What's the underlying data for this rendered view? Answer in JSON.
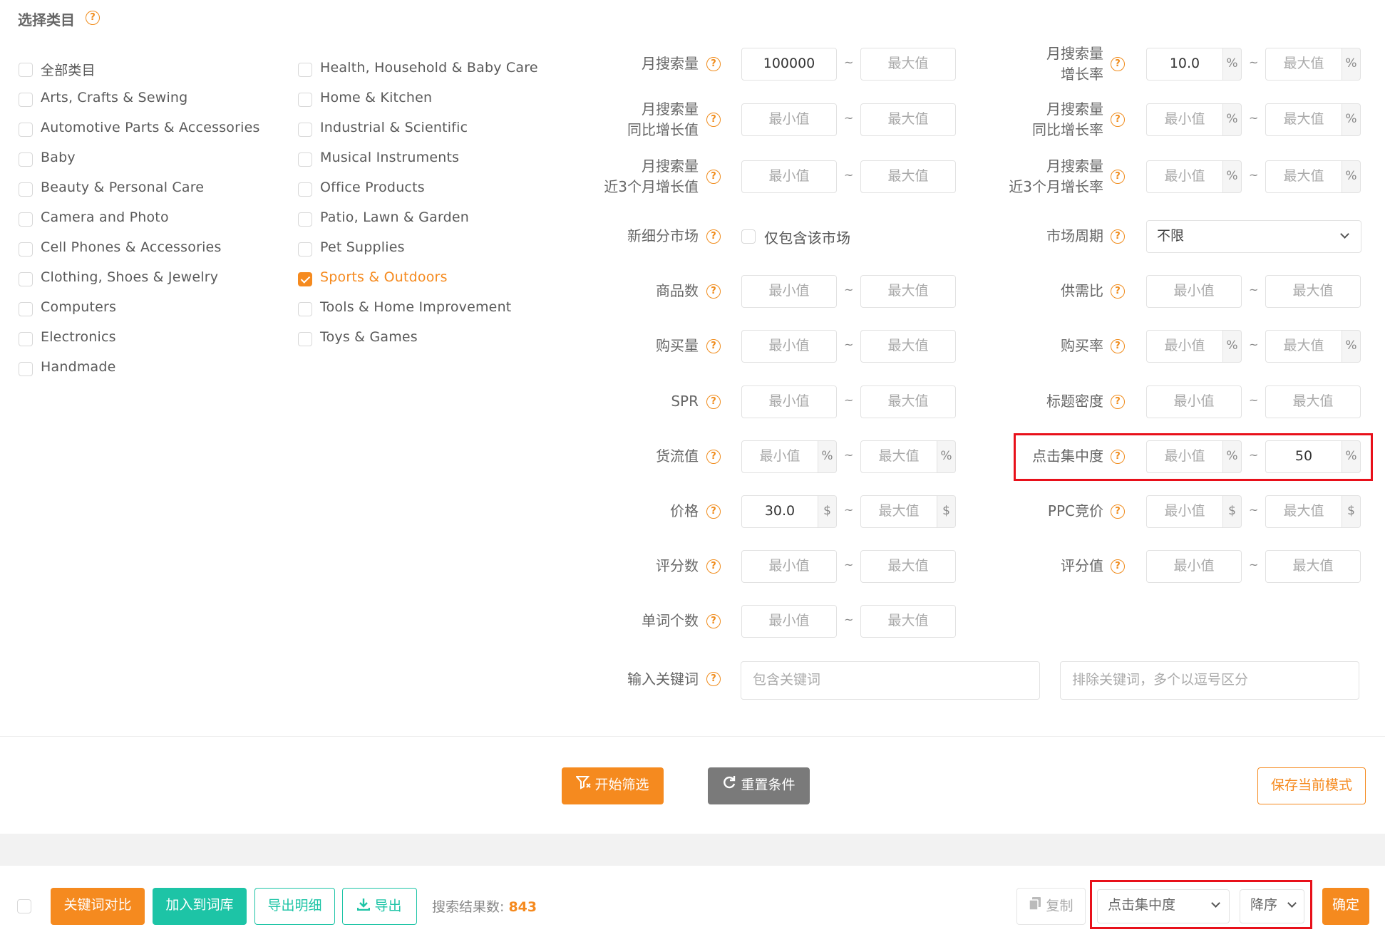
{
  "section_title": "选择类目",
  "categories_left": [
    "全部类目",
    "Arts, Crafts & Sewing",
    "Automotive Parts & Accessories",
    "Baby",
    "Beauty & Personal Care",
    "Camera and Photo",
    "Cell Phones & Accessories",
    "Clothing, Shoes & Jewelry",
    "Computers",
    "Electronics",
    "Handmade"
  ],
  "categories_right": [
    "Health, Household & Baby Care",
    "Home & Kitchen",
    "Industrial & Scientific",
    "Musical Instruments",
    "Office Products",
    "Patio, Lawn & Garden",
    "Pet Supplies",
    "Sports & Outdoors",
    "Tools & Home Improvement",
    "Toys & Games"
  ],
  "selected_category": "Sports & Outdoors",
  "placeholders": {
    "min": "最小值",
    "max": "最大值"
  },
  "filters_left": [
    {
      "label": "月搜索量",
      "min": "100000",
      "max": ""
    },
    {
      "label": "月搜索量同比增长值",
      "min": "",
      "max": ""
    },
    {
      "label": "月搜索量近3个月增长值",
      "min": "",
      "max": ""
    },
    {
      "label": "新细分市场",
      "checkbox": "仅包含该市场"
    },
    {
      "label": "商品数",
      "min": "",
      "max": ""
    },
    {
      "label": "购买量",
      "min": "",
      "max": ""
    },
    {
      "label": "SPR",
      "min": "",
      "max": ""
    },
    {
      "label": "货流值",
      "min": "",
      "max": "",
      "unit": "%"
    },
    {
      "label": "价格",
      "min": "30.0",
      "max": "",
      "unit": "$"
    },
    {
      "label": "评分数",
      "min": "",
      "max": ""
    },
    {
      "label": "单词个数",
      "min": "",
      "max": ""
    }
  ],
  "filters_right": [
    {
      "label": "月搜索量增长率",
      "min": "10.0",
      "max": "",
      "unit": "%"
    },
    {
      "label": "月搜索量同比增长率",
      "min": "",
      "max": "",
      "unit": "%"
    },
    {
      "label": "月搜索量近3个月增长率",
      "min": "",
      "max": "",
      "unit": "%"
    },
    {
      "label": "市场周期",
      "select": "不限"
    },
    {
      "label": "供需比",
      "min": "",
      "max": ""
    },
    {
      "label": "购买率",
      "min": "",
      "max": "",
      "unit": "%"
    },
    {
      "label": "标题密度",
      "min": "",
      "max": ""
    },
    {
      "label": "点击集中度",
      "min": "",
      "max": "50",
      "unit": "%"
    },
    {
      "label": "PPC竞价",
      "min": "",
      "max": "",
      "unit": "$"
    },
    {
      "label": "评分值",
      "min": "",
      "max": ""
    }
  ],
  "keywords": {
    "label": "输入关键词",
    "include_placeholder": "包含关键词",
    "exclude_placeholder": "排除关键词，多个以逗号区分"
  },
  "actions": {
    "start": "开始筛选",
    "reset": "重置条件",
    "save_mode": "保存当前模式"
  },
  "toolbar": {
    "compare": "关键词对比",
    "add_library": "加入到词库",
    "export_detail": "导出明细",
    "export": "导出",
    "result_label": "搜索结果数:",
    "result_count": "843",
    "copy": "复制",
    "sort_field": "点击集中度",
    "sort_order": "降序",
    "confirm": "确定"
  },
  "colors": {
    "accent": "#f58a1f",
    "teal": "#1dc4a6",
    "gray_btn": "#7a7a7a",
    "highlight": "#e8101a"
  }
}
